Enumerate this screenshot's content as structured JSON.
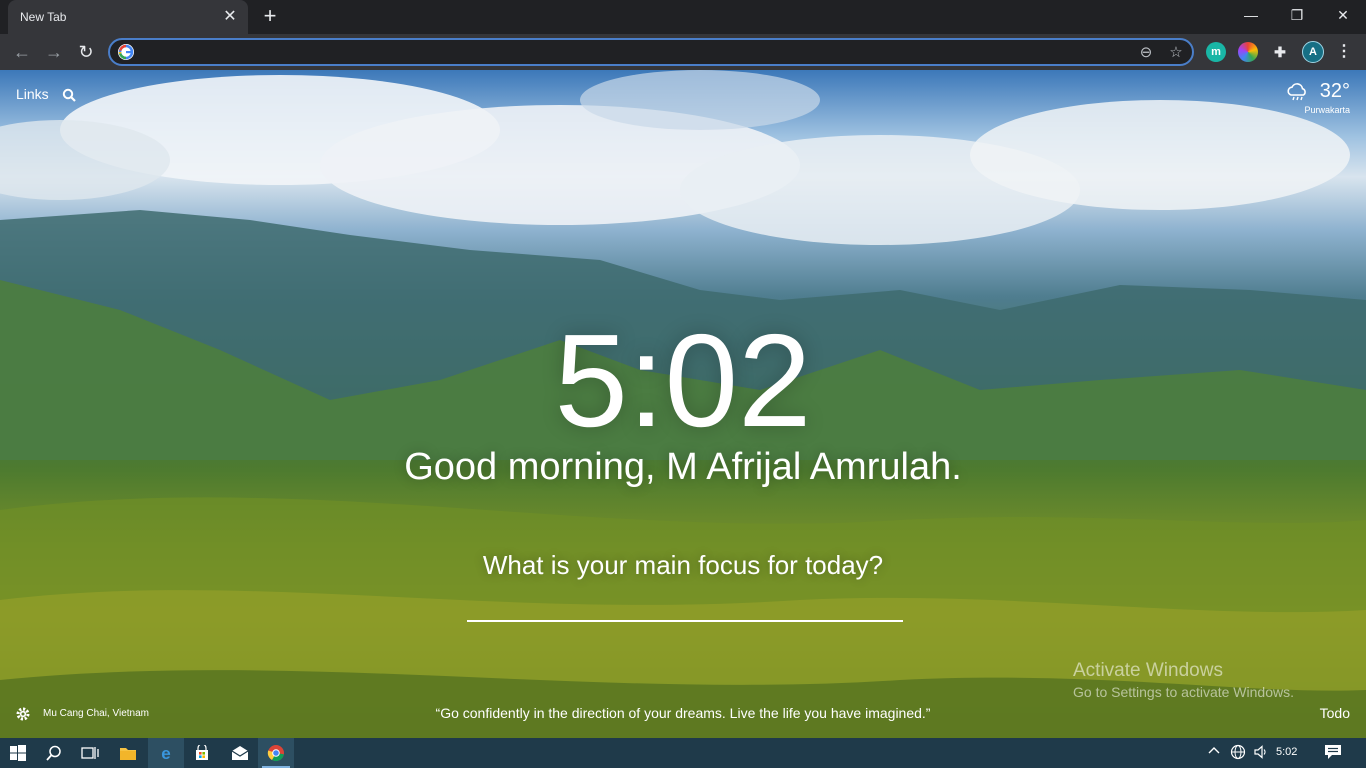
{
  "browser": {
    "tab_title": "New Tab",
    "tab_close": "✕",
    "new_tab": "+",
    "window_controls": {
      "minimize": "—",
      "restore": "❐",
      "close": "✕"
    },
    "nav": {
      "back": "←",
      "forward": "→",
      "reload": "↻"
    },
    "address_value": "",
    "icons": [
      "zoom-out-icon",
      "star-icon",
      "extension-m-icon",
      "extension-color-icon",
      "puzzle-icon",
      "profile-icon",
      "menu-icon"
    ],
    "ext_m_label": "m",
    "profile_initial": "A",
    "menu_glyph": "⋮",
    "puzzle_glyph": "✚",
    "star_glyph": "☆",
    "zoom_glyph": "⊖"
  },
  "page": {
    "links_label": "Links",
    "weather": {
      "temp": "32°",
      "location": "Purwakarta"
    },
    "clock": "5:02",
    "greeting": "Good morning, M Afrijal Amrulah.",
    "focus_question": "What is your main focus for today?",
    "focus_value": "",
    "photo_location": "Mu Cang Chai, Vietnam",
    "quote": "“Go confidently in the direction of your dreams. Live the life you have imagined.”",
    "todo_label": "Todo",
    "watermark": {
      "line1": "Activate Windows",
      "line2": "Go to Settings to activate Windows."
    }
  },
  "taskbar": {
    "time": "5:02",
    "icons": [
      "start-icon",
      "search-icon",
      "task-view-icon",
      "file-explorer-icon",
      "edge-icon",
      "store-icon",
      "mail-icon",
      "chrome-icon"
    ],
    "tray": [
      "chevron-up-icon",
      "globe-icon",
      "volume-icon",
      "notification-icon"
    ]
  },
  "colors": {
    "accent": "#4a7ec9",
    "chrome_dark": "#202124",
    "chrome_mid": "#35363a",
    "taskbar": "#1f3a4a"
  }
}
